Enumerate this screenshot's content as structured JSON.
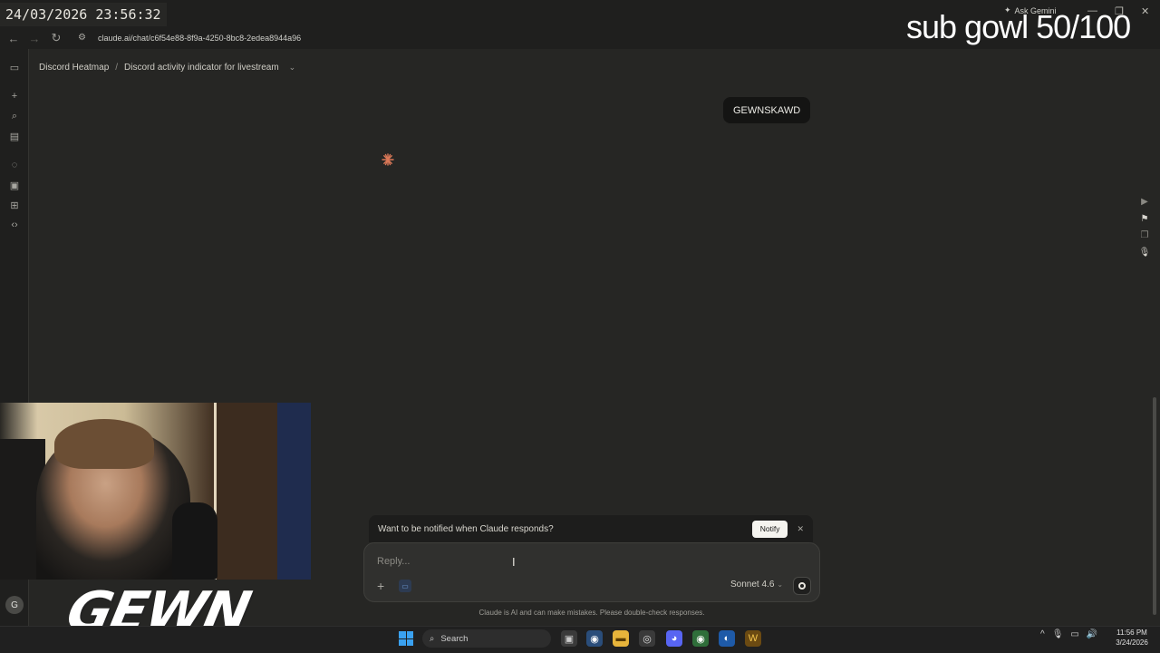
{
  "overlay": {
    "datetime": "24/03/2026 23:56:32",
    "goal": "sub gowl 50/100",
    "logo_text": "GEWN"
  },
  "browser": {
    "url": "claude.ai/chat/c6f54e88-8f9a-4250-8bc8-2edea8944a96",
    "ask_gemini": "Ask Gemini"
  },
  "breadcrumb": {
    "project": "Discord Heatmap",
    "separator": "/",
    "chat_title": "Discord activity indicator for livestream"
  },
  "conversation": {
    "user_message": "GEWNSKAWD"
  },
  "notify_banner": {
    "text": "Want to be notified when Claude responds?",
    "button": "Notify"
  },
  "composer": {
    "placeholder": "Reply...",
    "model": "Sonnet 4.6"
  },
  "disclaimer": "Claude is AI and can make mistakes. Please double-check responses.",
  "account": {
    "initial": "G"
  },
  "taskbar": {
    "search_label": "Search",
    "time": "11:56 PM",
    "date": "3/24/2026"
  },
  "colors": {
    "accent": "#d97757",
    "background": "#262624"
  }
}
